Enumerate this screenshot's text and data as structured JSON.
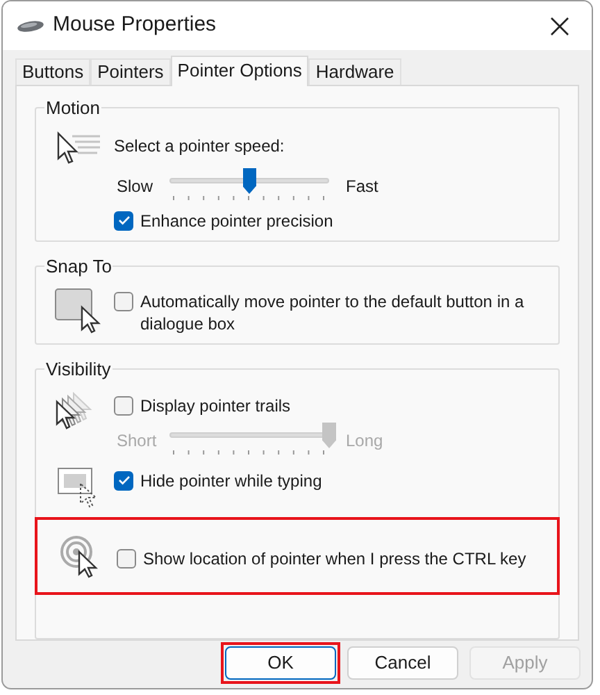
{
  "window": {
    "title": "Mouse Properties"
  },
  "tabs": [
    {
      "label": "Buttons",
      "selected": false
    },
    {
      "label": "Pointers",
      "selected": false
    },
    {
      "label": "Pointer Options",
      "selected": true
    },
    {
      "label": "Hardware",
      "selected": false
    }
  ],
  "groups": [
    {
      "title": "Motion",
      "rows": [
        {
          "highlighted": false,
          "items": [
            {
              "kind": "slider",
              "label": "Select a pointer speed:",
              "min_label": "Slow",
              "max_label": "Fast",
              "level": 0.5,
              "disabled": false
            },
            {
              "kind": "checkbox",
              "label": "Enhance pointer precision",
              "checked": true
            }
          ]
        }
      ]
    },
    {
      "title": "Snap To",
      "rows": [
        {
          "highlighted": false,
          "items": [
            {
              "kind": "checkbox",
              "label": "Automatically move pointer to the default button in a dialogue box",
              "checked": false
            }
          ]
        }
      ]
    },
    {
      "title": "Visibility",
      "rows": [
        {
          "highlighted": false,
          "items": [
            {
              "kind": "checkbox",
              "label": "Display pointer trails",
              "checked": false
            },
            {
              "kind": "slider",
              "min_label": "Short",
              "max_label": "Long",
              "level": 1,
              "disabled": true
            }
          ]
        },
        {
          "highlighted": false,
          "items": [
            {
              "kind": "checkbox",
              "label": "Hide pointer while typing",
              "checked": true
            }
          ]
        },
        {
          "highlighted": true,
          "items": [
            {
              "kind": "checkbox",
              "label": "Show location of pointer when I press the CTRL key",
              "checked": false
            }
          ]
        }
      ]
    }
  ],
  "buttons": [
    {
      "label": "OK",
      "default": true,
      "disabled": false,
      "highlighted": true
    },
    {
      "label": "Cancel",
      "default": false,
      "disabled": false,
      "highlighted": false
    },
    {
      "label": "Apply",
      "default": false,
      "disabled": true,
      "highlighted": false
    }
  ]
}
